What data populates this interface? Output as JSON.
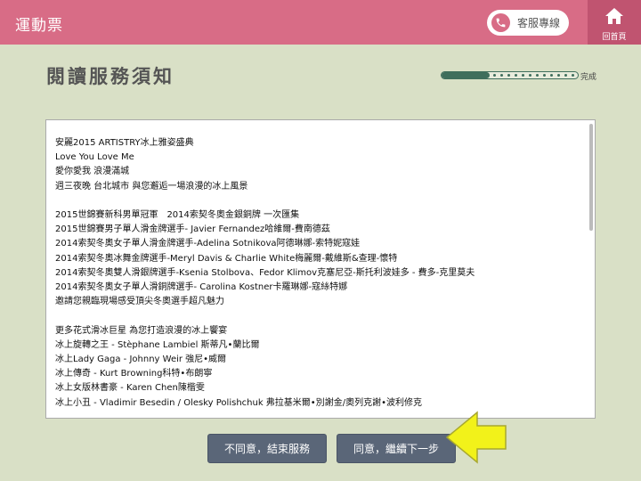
{
  "header": {
    "brand": "運動票",
    "service_label": "客服專線",
    "home_label": "回首頁"
  },
  "page": {
    "title": "閱讀服務須知",
    "progress_label": "完成",
    "progress_fraction": 0.35
  },
  "notice_lines": [
    "安麗2015 ARTISTRY冰上雅姿盛典",
    "Love You Love Me",
    "愛你愛我 浪漫滿城",
    "週三夜晚 台北城市 與您邂逅一場浪漫的冰上風景",
    "",
    "2015世錦賽新科男單冠軍　2014索契冬奧金銀銅牌 一次匯集",
    "2015世錦賽男子單人滑金牌選手- Javier Fernandez哈維爾-費南德茲",
    "2014索契冬奧女子單人滑金牌選手-Adelina Sotnikova阿德琳娜-索特妮寇娃",
    "2014索契冬奧冰舞金牌選手-Meryl Davis & Charlie White梅麗爾-戴維斯&查理-懷特",
    "2014索契冬奧雙人滑銀牌選手-Ksenia Stolbova、Fedor Klimov克塞尼亞-斯托利波娃多 - 費多-克里莫夫",
    "2014索契冬奧女子單人滑銅牌選手- Carolina Kostner卡羅琳娜-寇絲特娜",
    "邀請您親臨現場感受頂尖冬奧選手超凡魅力",
    "",
    "更多花式滑冰巨星 為您打造浪漫的冰上饗宴",
    "冰上旋轉之王 - Stèphane Lambiel 斯蒂凡•蘭比爾",
    "冰上Lady Gaga - Johnny Weir 強尼•威爾",
    "冰上傳奇 - Kurt Browning科特•布朗寧",
    "冰上女版林書豪 - Karen Chen陳楷雯",
    "冰上小丑 - Vladimir Besedin / Olesky Polishchuk 弗拉基米爾•別謝金/奧列克謝•波利修克"
  ],
  "buttons": {
    "disagree": "不同意，結束服務",
    "agree": "同意，繼續下一步"
  },
  "colors": {
    "header": "#d86c86",
    "background": "#d9e0c6",
    "button": "#5a6678",
    "progress": "#3f6e5c",
    "arrow": "#f2f21a"
  },
  "icons": {
    "service": "phone-icon",
    "home": "home-icon",
    "pointer": "arrow-left-icon"
  }
}
